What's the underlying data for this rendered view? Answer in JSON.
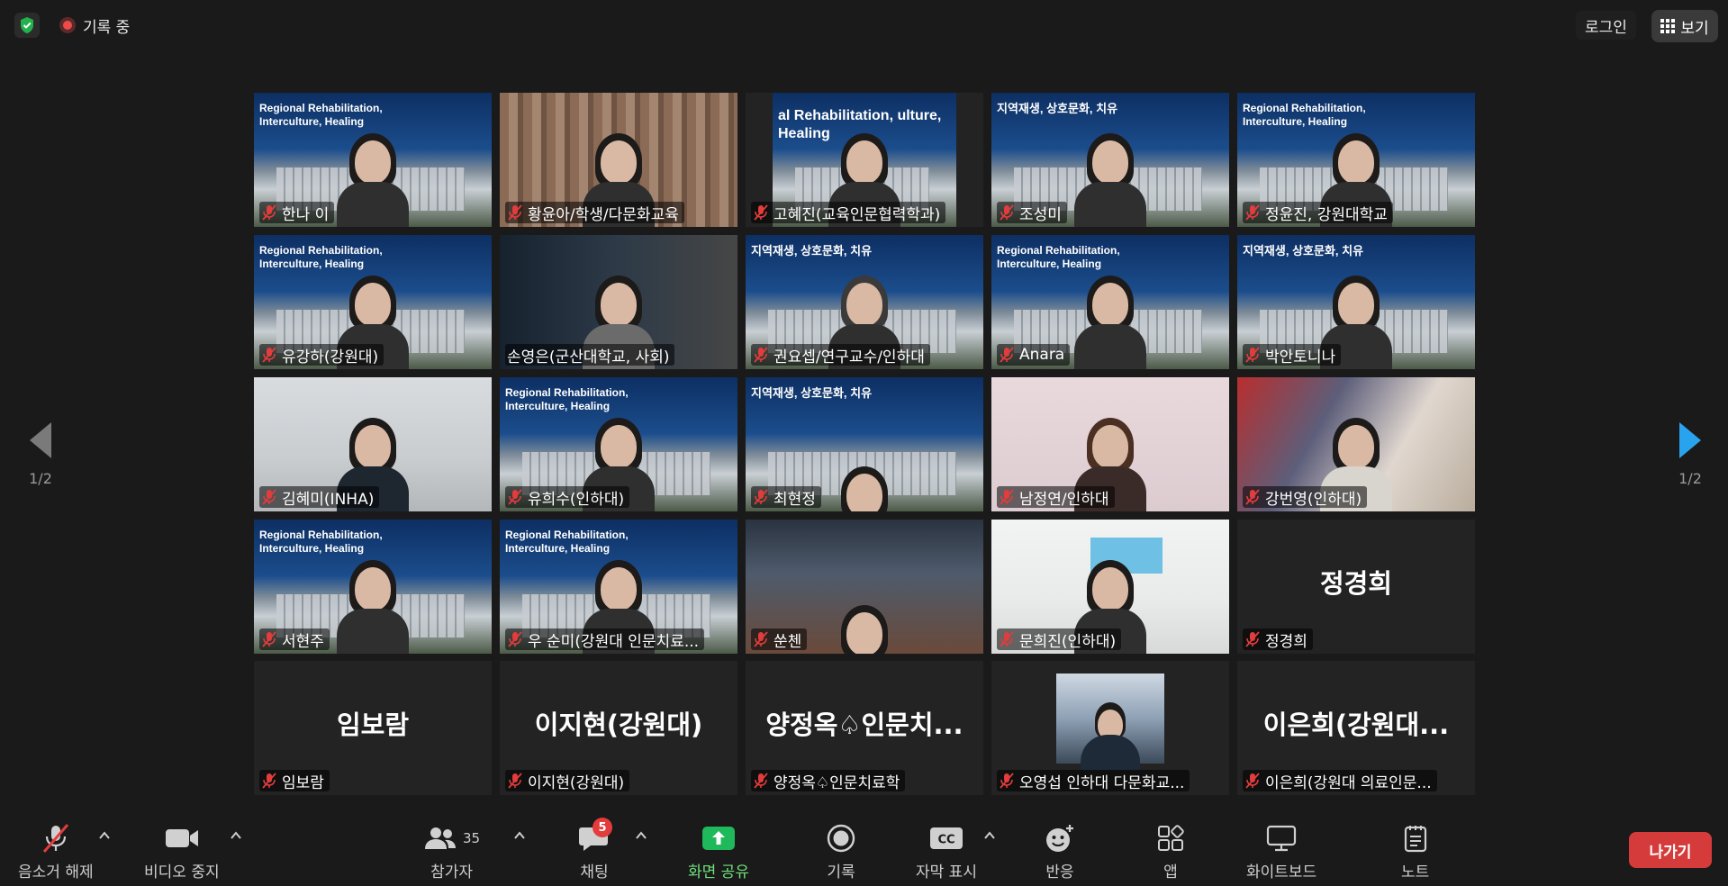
{
  "header": {
    "recording_label": "기록 중",
    "login_label": "로그인",
    "view_label": "보기"
  },
  "pager": {
    "left": "1/2",
    "right": "1/2"
  },
  "banner": {
    "en_title": "Regional Rehabilitation, Interculture, Healing",
    "en_title_cropped": "al Rehabilitation, ulture, Healing",
    "ko_title": "지역재생, 상호문화, 치유"
  },
  "participants": [
    {
      "name": "한나 이"
    },
    {
      "name": "황윤아/학생/다문화교육"
    },
    {
      "name": "고혜진(교육인문협력학과)"
    },
    {
      "name": "조성미"
    },
    {
      "name": "정윤진, 강원대학교"
    },
    {
      "name": "유강하(강원대)"
    },
    {
      "name": "손영은(군산대학교, 사회)"
    },
    {
      "name": "권요셉/연구교수/인하대"
    },
    {
      "name": "Anara"
    },
    {
      "name": "박안토니나"
    },
    {
      "name": "김혜미(INHA)"
    },
    {
      "name": "유희수(인하대)"
    },
    {
      "name": "최현정"
    },
    {
      "name": "남정연/인하대"
    },
    {
      "name": "강번영(인하대)"
    },
    {
      "name": "서현주"
    },
    {
      "name": "우 순미(강원대 인문치료..."
    },
    {
      "name": "쑨첸"
    },
    {
      "name": "문희진(인하대)"
    },
    {
      "name": "정경희",
      "big": "정경희"
    },
    {
      "name": "임보람",
      "big": "임보람"
    },
    {
      "name": "이지현(강원대)",
      "big": "이지현(강원대)"
    },
    {
      "name": "양정옥♤인문치료학",
      "big": "양정옥♤인문치..."
    },
    {
      "name": "오영섭 인하대 다문화교..."
    },
    {
      "name": "이은희(강원대 의료인문...",
      "big": "이은희(강원대..."
    }
  ],
  "toolbar": {
    "unmute": "음소거 해제",
    "stop_video": "비디오 중지",
    "participants": "참가자",
    "participants_count": "35",
    "chat": "채팅",
    "chat_badge": "5",
    "share": "화면 공유",
    "record": "기록",
    "captions": "자막 표시",
    "reactions": "반응",
    "apps": "앱",
    "whiteboard": "화이트보드",
    "notes": "노트",
    "leave": "나가기"
  },
  "colors": {
    "active_speaker_outline": "#9be35a",
    "share_green": "#1fb85b",
    "leave_red": "#d63b3b",
    "badge_red": "#e23c3c",
    "pager_arrow_right": "#2aa3ef",
    "pager_arrow_left": "#7a7a7a"
  },
  "icons": [
    "shield-check-icon",
    "record-icon",
    "grid-icon",
    "mic-off-icon",
    "video-icon",
    "people-icon",
    "chat-icon",
    "share-screen-icon",
    "record-button-icon",
    "cc-icon",
    "emoji-icon",
    "apps-icon",
    "whiteboard-icon",
    "notes-icon",
    "chevron-up-icon"
  ]
}
